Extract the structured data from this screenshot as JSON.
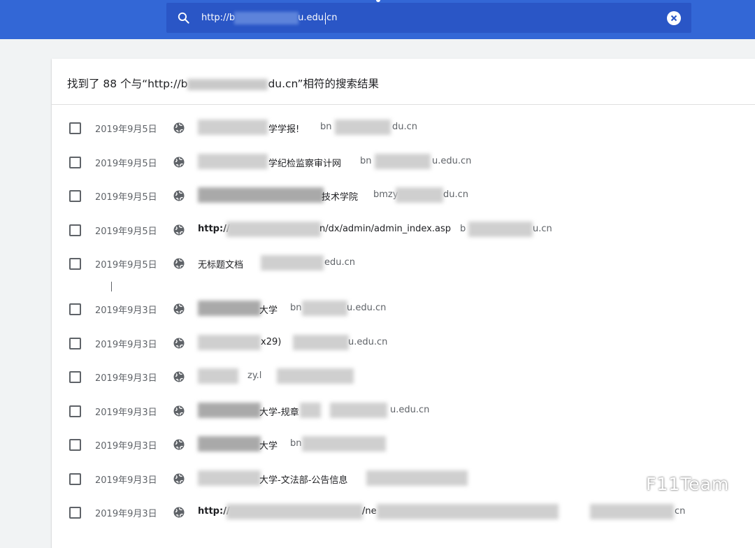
{
  "search": {
    "value": "http://b                    u.edu.cn",
    "visible_prefix": "http://b",
    "visible_suffix": "u.edu.cn"
  },
  "results": {
    "summary": "找到了 88 个与“http://b                  du.cn”相符的搜索结果",
    "summary_prefix": "找到了 88 个与“http://b",
    "summary_suffix": "du.cn”相符的搜索结果",
    "rows": [
      {
        "date": "2019年9月5日",
        "title": "学学报!",
        "domain": "bn",
        "domain_suffix": "du.cn"
      },
      {
        "date": "2019年9月5日",
        "title": "学纪检监察审计网",
        "domain": "bn",
        "domain_suffix": "u.edu.cn"
      },
      {
        "date": "2019年9月5日",
        "title": "技术学院",
        "domain": "bmzy",
        "domain_suffix": "du.cn"
      },
      {
        "date": "2019年9月5日",
        "title_prefix": "http://",
        "title_suffix": "n/dx/admin/admin_index.asp",
        "domain": "b",
        "domain_suffix": "u.cn"
      },
      {
        "date": "2019年9月5日",
        "title": "无标题文档",
        "domain_suffix": "edu.cn"
      },
      {
        "date": "2019年9月3日",
        "title": "大学",
        "domain": "bn",
        "domain_suffix": "u.edu.cn"
      },
      {
        "date": "2019年9月3日",
        "title": "x29)",
        "domain_suffix": "u.edu.cn"
      },
      {
        "date": "2019年9月3日",
        "title": "zy.l",
        "domain_suffix": ""
      },
      {
        "date": "2019年9月3日",
        "title": "大学-规章",
        "domain_suffix": "u.edu.cn"
      },
      {
        "date": "2019年9月3日",
        "title": "大学",
        "domain": "bn",
        "domain_suffix": ""
      },
      {
        "date": "2019年9月3日",
        "title": "大学-文法部-公告信息",
        "domain_suffix": ""
      },
      {
        "date": "2019年9月3日",
        "title_prefix": "http://",
        "title_suffix": "/ne",
        "domain_suffix": "cn"
      }
    ]
  },
  "watermark": {
    "text": "F11Team"
  },
  "colors": {
    "topbar": "#3367d6",
    "search_box": "#2a56c6",
    "background": "#f1f3f4"
  }
}
